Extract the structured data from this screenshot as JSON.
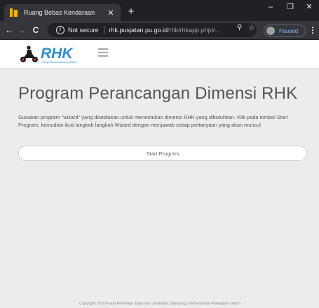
{
  "browser": {
    "tab_title": "Ruang Bebas Kendaraan",
    "tab_close": "✕",
    "new_tab": "+",
    "window_minimize": "–",
    "window_maximize": "❐",
    "window_close": "✕",
    "back": "←",
    "forward": "→",
    "reload": "C",
    "security_label": "Not secure",
    "url_host": "rhk.pusjatan.pu.go.id",
    "url_path": "/rhk/rhkapp.php#...",
    "zoom_icon": "⚲",
    "star_icon": "☆",
    "profile_label": "Paused",
    "menu_icon": "⋮"
  },
  "app": {
    "logo_text": "RHK",
    "logo_tagline": "ruang bebas kendaraan application",
    "brand_color": "#2f8fd0"
  },
  "main": {
    "title": "Program Perancangan Dimensi RHK",
    "description": "Gunakan program \"wizard\" yang disediakan untuk menentukan dimensi RHK yang dibutuhkan. Klik pada tombol Start Program, kemudian ikuti langkah langkah Wizard dengan menjawab setiap pertanyaan yang akan muncul",
    "start_button": "Start Program"
  },
  "footer": {
    "text": "Copyright 2019 Pusat Penelitian Jalan dan Jembatan, Bandung | Kementerian Pekerjaan Umum"
  }
}
